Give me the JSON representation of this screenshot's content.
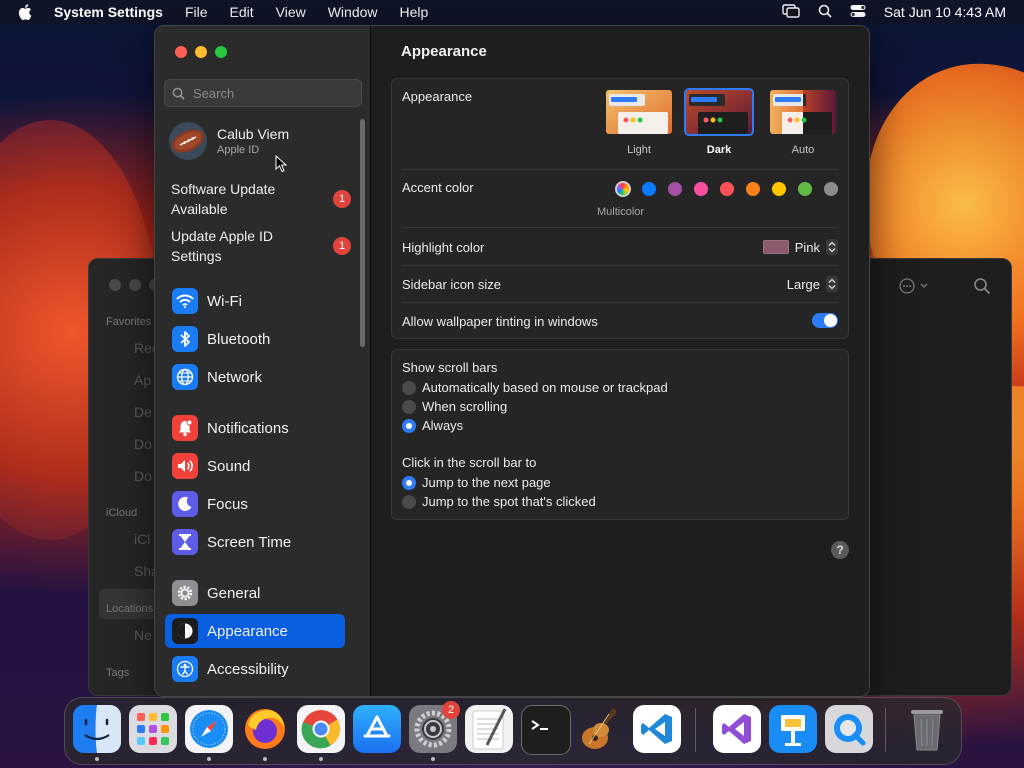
{
  "menubar": {
    "app_name": "System Settings",
    "items": [
      "File",
      "Edit",
      "View",
      "Window",
      "Help"
    ],
    "clock": "Sat Jun 10  4:43 AM"
  },
  "finder": {
    "sections": [
      "Favorites",
      "iCloud",
      "Locations",
      "Tags"
    ],
    "rows": [
      "Rec",
      "Ap",
      "De",
      "Do",
      "Do",
      "iCl",
      "Sha",
      "Ne"
    ]
  },
  "sidebar": {
    "search_placeholder": "Search",
    "profile": {
      "name": "Calub Viem",
      "subtitle": "Apple ID"
    },
    "notices": [
      {
        "label": "Software Update Available",
        "badge": "1"
      },
      {
        "label": "Update Apple ID Settings",
        "badge": "1"
      }
    ],
    "items": [
      {
        "label": "Wi-Fi",
        "icon": "wifi-icon",
        "color": "#1a7cf5"
      },
      {
        "label": "Bluetooth",
        "icon": "bluetooth-icon",
        "color": "#1a7cf5"
      },
      {
        "label": "Network",
        "icon": "globe-icon",
        "color": "#1a7cf5"
      },
      {
        "label": "Notifications",
        "icon": "bell-icon",
        "color": "#f0413a"
      },
      {
        "label": "Sound",
        "icon": "speaker-icon",
        "color": "#f0413a"
      },
      {
        "label": "Focus",
        "icon": "moon-icon",
        "color": "#5e5ce6"
      },
      {
        "label": "Screen Time",
        "icon": "hourglass-icon",
        "color": "#5e5ce6"
      },
      {
        "label": "General",
        "icon": "gear-icon",
        "color": "#8e8e93"
      },
      {
        "label": "Appearance",
        "icon": "appearance-icon",
        "color": "#1c1c1e"
      },
      {
        "label": "Accessibility",
        "icon": "accessibility-icon",
        "color": "#1a7cf5"
      }
    ],
    "selected": "Appearance"
  },
  "main": {
    "title": "Appearance",
    "appearance": {
      "label": "Appearance",
      "options": [
        "Light",
        "Dark",
        "Auto"
      ],
      "selected": "Dark"
    },
    "accent": {
      "label": "Accent color",
      "colors": [
        "#0a7cff",
        "#a550a7",
        "#f74f9e",
        "#ff5257",
        "#f7821b",
        "#ffc600",
        "#62ba46",
        "#8c8c8c"
      ],
      "selected_label": "Multicolor"
    },
    "highlight": {
      "label": "Highlight color",
      "value": "Pink",
      "chip_color": "#8c5a6e"
    },
    "icon_size": {
      "label": "Sidebar icon size",
      "value": "Large"
    },
    "tinting": {
      "label": "Allow wallpaper tinting in windows",
      "enabled": true
    },
    "scroll_bars": {
      "label": "Show scroll bars",
      "options": [
        "Automatically based on mouse or trackpad",
        "When scrolling",
        "Always"
      ],
      "selected": "Always"
    },
    "click_scroll": {
      "label": "Click in the scroll bar to",
      "options": [
        "Jump to the next page",
        "Jump to the spot that's clicked"
      ],
      "selected": "Jump to the next page"
    },
    "help": "?"
  },
  "dock": {
    "apps": [
      "Finder",
      "Launchpad",
      "Safari",
      "Firefox",
      "Chrome",
      "App Store",
      "System Settings",
      "TextEdit",
      "Terminal",
      "GarageBand",
      "VS Code",
      "Visual Studio",
      "Keynote",
      "QuickTime",
      "Trash"
    ],
    "settings_badge": "2"
  }
}
